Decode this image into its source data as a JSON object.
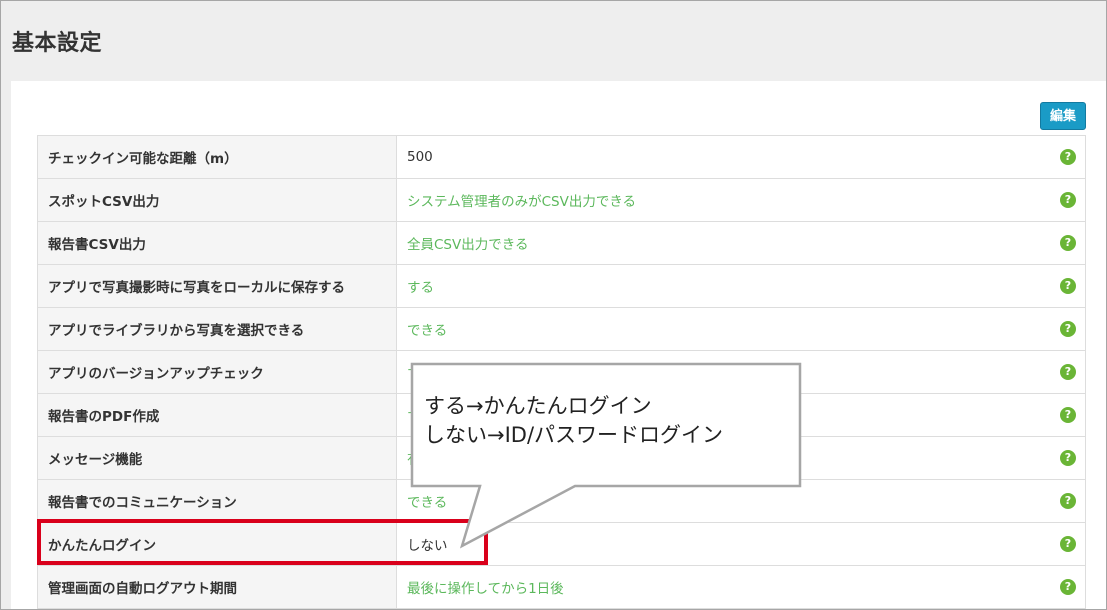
{
  "page": {
    "title": "基本設定",
    "edit_label": "編集"
  },
  "rows": [
    {
      "label": "チェックイン可能な距離（m）",
      "value": "500",
      "green": false
    },
    {
      "label": "スポットCSV出力",
      "value": "システム管理者のみがCSV出力できる",
      "green": true
    },
    {
      "label": "報告書CSV出力",
      "value": "全員CSV出力できる",
      "green": true
    },
    {
      "label": "アプリで写真撮影時に写真をローカルに保存する",
      "value": "する",
      "green": true
    },
    {
      "label": "アプリでライブラリから写真を選択できる",
      "value": "できる",
      "green": true
    },
    {
      "label": "アプリのバージョンアップチェック",
      "value": "す",
      "green": true
    },
    {
      "label": "報告書のPDF作成",
      "value": "す",
      "green": true
    },
    {
      "label": "メッセージ機能",
      "value": "有",
      "green": true
    },
    {
      "label": "報告書でのコミュニケーション",
      "value": "できる",
      "green": true
    },
    {
      "label": "かんたんログイン",
      "value": "しない",
      "green": false
    },
    {
      "label": "管理画面の自動ログアウト期間",
      "value": "最後に操作してから1日後",
      "green": true
    }
  ],
  "help_icon": {
    "glyph": "?",
    "name": "help-icon",
    "color": "#6ab536"
  },
  "callout": {
    "line1": "する→かんたんログイン",
    "line2": "しない→ID/パスワードログイン"
  },
  "colors": {
    "accent_button": "#1a9bc6",
    "value_green": "#5cb85c",
    "highlight_red": "#d9001b"
  }
}
